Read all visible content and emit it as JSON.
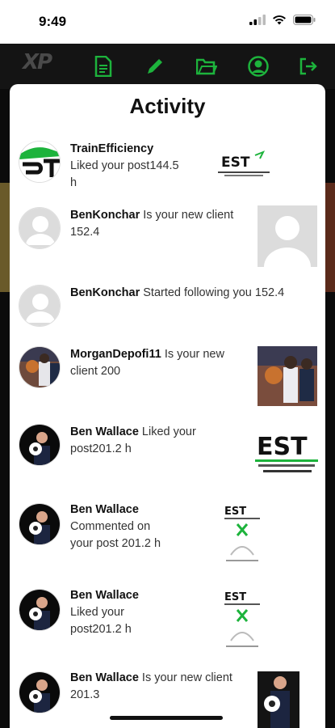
{
  "status_bar": {
    "time": "9:49"
  },
  "nav": {
    "logo_text": "XP",
    "items": [
      "document-icon",
      "pencil-icon",
      "folder-icon",
      "profile-icon",
      "logout-icon"
    ],
    "icon_color": "#1db33c"
  },
  "modal": {
    "title": "Activity"
  },
  "activity": [
    {
      "user": "TrainEfficiency",
      "text": " Liked your post144.5 h",
      "thumb_label": "EST"
    },
    {
      "user": "BenKonchar",
      "text": " Is your new client 152.4",
      "thumb_label": ""
    },
    {
      "user": "BenKonchar",
      "text": " Started following you 152.4",
      "thumb_label": ""
    },
    {
      "user": "MorganDepofi11",
      "text": " Is your new client 200",
      "thumb_label": ""
    },
    {
      "user": "Ben Wallace",
      "text": " Liked your post201.2 h",
      "thumb_label": "EST"
    },
    {
      "user": "Ben Wallace",
      "text": " Commented on your post 201.2 h",
      "thumb_label": "EST"
    },
    {
      "user": "Ben Wallace",
      "text": " Liked your post201.2 h",
      "thumb_label": "EST"
    },
    {
      "user": "Ben Wallace",
      "text": " Is your new client 201.3",
      "thumb_label": ""
    }
  ]
}
